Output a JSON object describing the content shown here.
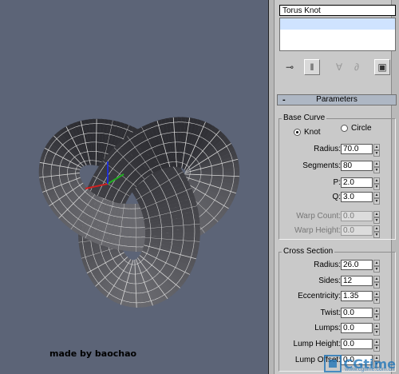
{
  "viewport": {
    "caption": "made by baochao",
    "background_color": "#5c6477",
    "mesh_color": "#d8d8d8",
    "gizmo_colors": {
      "x": "#d02020",
      "y": "#20b020",
      "z": "#2030d0"
    }
  },
  "panel": {
    "object_name": "Torus Knot",
    "toolbar_icons": [
      "pin-stack-icon",
      "show-end-result-icon",
      "make-unique-icon",
      "remove-modifier-icon",
      "configure-modifier-sets-icon"
    ],
    "rollout_title": "Parameters",
    "base_curve": {
      "title": "Base Curve",
      "radio_knot": "Knot",
      "radio_circle": "Circle",
      "selected": "Knot",
      "radius_label": "Radius:",
      "radius_value": "70.0",
      "segments_label": "Segments:",
      "segments_value": "80",
      "p_label": "P:",
      "p_value": "2.0",
      "q_label": "Q:",
      "q_value": "3.0",
      "warp_count_label": "Warp Count:",
      "warp_count_value": "0.0",
      "warp_height_label": "Warp Height:",
      "warp_height_value": "0.0"
    },
    "cross_section": {
      "title": "Cross Section",
      "radius_label": "Radius:",
      "radius_value": "26.0",
      "sides_label": "Sides:",
      "sides_value": "12",
      "eccentricity_label": "Eccentricity:",
      "eccentricity_value": "1.35",
      "twist_label": "Twist:",
      "twist_value": "0.0",
      "lumps_label": "Lumps:",
      "lumps_value": "0.0",
      "lump_height_label": "Lump Height:",
      "lump_height_value": "0.0",
      "lump_offset_label": "Lump Offset:",
      "lump_offset_value": "0.0"
    }
  },
  "watermark": {
    "text": "CGtime",
    "sub": "www.cgtime.com.cn"
  }
}
